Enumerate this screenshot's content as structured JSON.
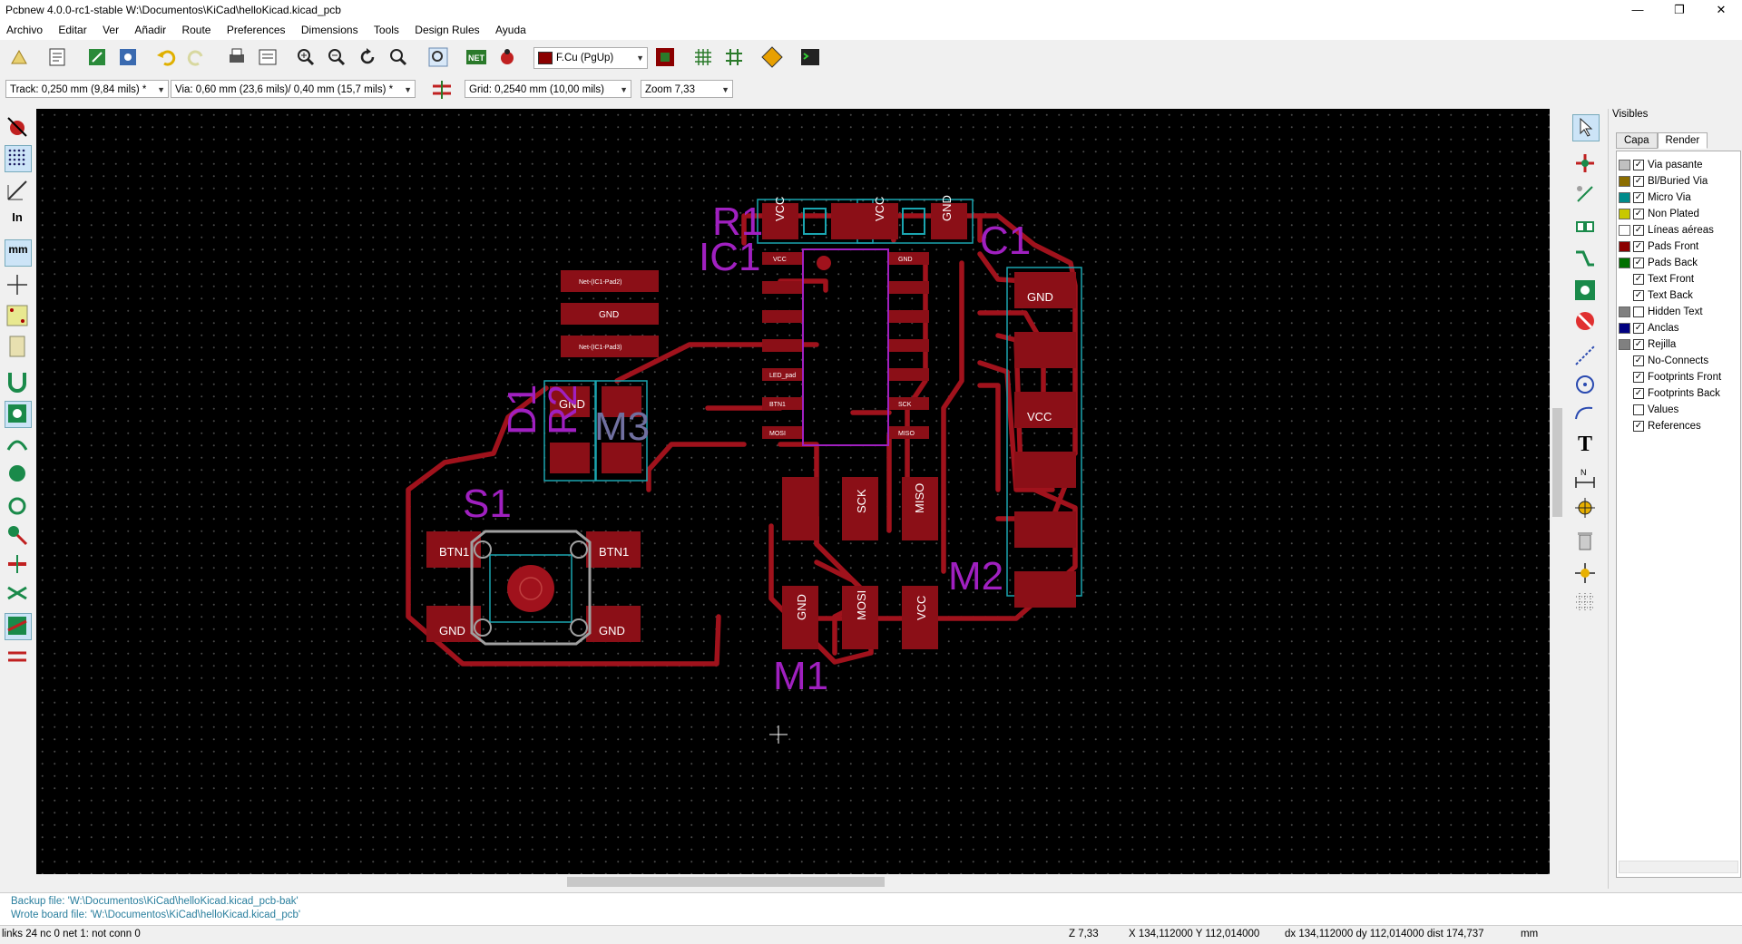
{
  "window": {
    "title": "Pcbnew 4.0.0-rc1-stable W:\\Documentos\\KiCad\\helloKicad.kicad_pcb",
    "minimize": "—",
    "maximize": "❐",
    "close": "✕"
  },
  "menu": [
    "Archivo",
    "Editar",
    "Ver",
    "Añadir",
    "Route",
    "Preferences",
    "Dimensions",
    "Tools",
    "Design Rules",
    "Ayuda"
  ],
  "toolbar": {
    "layer_select": "F.Cu (PgUp)",
    "layer_color": "#8b0000"
  },
  "toolbar2": {
    "track": "Track: 0,250 mm (9,84 mils) *",
    "via": "Via: 0,60 mm (23,6 mils)/ 0,40 mm (15,7 mils) *",
    "grid": "Grid: 0,2540 mm (10,00 mils)",
    "zoom": "Zoom 7,33"
  },
  "left_toolbar": {
    "units_in": "In",
    "units_mm": "mm"
  },
  "visibles": {
    "header": "Visibles",
    "tabs": [
      "Capa",
      "Render"
    ],
    "active_tab": "Render",
    "items": [
      {
        "label": "Via pasante",
        "color": "#c0c0c0",
        "checked": true
      },
      {
        "label": "Bl/Buried Via",
        "color": "#8b6d00",
        "checked": true
      },
      {
        "label": "Micro Via",
        "color": "#008b8b",
        "checked": true
      },
      {
        "label": "Non Plated",
        "color": "#c8c800",
        "checked": true
      },
      {
        "label": "Líneas aéreas",
        "color": "#ffffff",
        "checked": true
      },
      {
        "label": "Pads Front",
        "color": "#8b0000",
        "checked": true
      },
      {
        "label": "Pads Back",
        "color": "#007000",
        "checked": true
      },
      {
        "label": "Text Front",
        "color": null,
        "checked": true
      },
      {
        "label": "Text Back",
        "color": null,
        "checked": true
      },
      {
        "label": "Hidden Text",
        "color": "#808080",
        "checked": false
      },
      {
        "label": "Anclas",
        "color": "#000080",
        "checked": true
      },
      {
        "label": "Rejilla",
        "color": "#808080",
        "checked": true
      },
      {
        "label": "No-Connects",
        "color": null,
        "checked": true
      },
      {
        "label": "Footprints Front",
        "color": null,
        "checked": true
      },
      {
        "label": "Footprints Back",
        "color": null,
        "checked": true
      },
      {
        "label": "Values",
        "color": null,
        "checked": false
      },
      {
        "label": "References",
        "color": null,
        "checked": true
      }
    ]
  },
  "messages": [
    "Backup file: 'W:\\Documentos\\KiCad\\helloKicad.kicad_pcb-bak'",
    "Wrote board file: 'W:\\Documentos\\KiCad\\helloKicad.kicad_pcb'"
  ],
  "status": {
    "links": "links 24 nc 0  net 1: not conn 0",
    "zoom": "Z 7,33",
    "xy": "X 134,112000  Y 112,014000",
    "dxy": "dx 134,112000  dy 112,014000  dist 174,737",
    "units": "mm"
  },
  "pcb": {
    "ref_R1": "R1",
    "ref_C1": "C1",
    "ref_IC1": "IC1",
    "ref_D1": "D1",
    "ref_R2": "R2",
    "ref_M3": "M3",
    "ref_S1": "S1",
    "ref_M2": "M2",
    "ref_M1": "M1",
    "vcc": "VCC",
    "gnd": "GND",
    "btn1": "BTN1",
    "mosi": "MOSI",
    "sck": "SCK",
    "miso": "MISO",
    "net_pad2": "Net-(IC1-Pad2)",
    "net_pad3": "Net-(IC1-Pad3)",
    "led_pad": "LED_pad"
  }
}
